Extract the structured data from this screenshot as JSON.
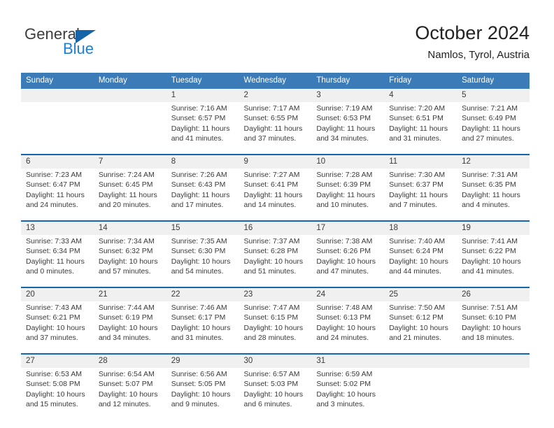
{
  "brand": {
    "name_part1": "General",
    "name_part2": "Blue",
    "triangle_icon": "triangle-icon",
    "accent_dark": "#1565a8",
    "accent_light": "#1d7fd4"
  },
  "header": {
    "title": "October 2024",
    "subtitle": "Namlos, Tyrol, Austria"
  },
  "theme": {
    "header_bg": "#3b7cb8",
    "header_text": "#ffffff",
    "daynum_bg": "#f0f0f0",
    "rule_color": "#1565a8"
  },
  "weekday_headers": [
    "Sunday",
    "Monday",
    "Tuesday",
    "Wednesday",
    "Thursday",
    "Friday",
    "Saturday"
  ],
  "labels": {
    "sunrise_prefix": "Sunrise:",
    "sunset_prefix": "Sunset:",
    "daylight_prefix": "Daylight:"
  },
  "weeks": [
    {
      "days": [
        {
          "num": "",
          "sunrise": "",
          "sunset": "",
          "daylight_l1": "",
          "daylight_l2": "",
          "empty": true
        },
        {
          "num": "",
          "sunrise": "",
          "sunset": "",
          "daylight_l1": "",
          "daylight_l2": "",
          "empty": true
        },
        {
          "num": "1",
          "sunrise": "Sunrise: 7:16 AM",
          "sunset": "Sunset: 6:57 PM",
          "daylight_l1": "Daylight: 11 hours",
          "daylight_l2": "and 41 minutes.",
          "empty": false
        },
        {
          "num": "2",
          "sunrise": "Sunrise: 7:17 AM",
          "sunset": "Sunset: 6:55 PM",
          "daylight_l1": "Daylight: 11 hours",
          "daylight_l2": "and 37 minutes.",
          "empty": false
        },
        {
          "num": "3",
          "sunrise": "Sunrise: 7:19 AM",
          "sunset": "Sunset: 6:53 PM",
          "daylight_l1": "Daylight: 11 hours",
          "daylight_l2": "and 34 minutes.",
          "empty": false
        },
        {
          "num": "4",
          "sunrise": "Sunrise: 7:20 AM",
          "sunset": "Sunset: 6:51 PM",
          "daylight_l1": "Daylight: 11 hours",
          "daylight_l2": "and 31 minutes.",
          "empty": false
        },
        {
          "num": "5",
          "sunrise": "Sunrise: 7:21 AM",
          "sunset": "Sunset: 6:49 PM",
          "daylight_l1": "Daylight: 11 hours",
          "daylight_l2": "and 27 minutes.",
          "empty": false
        }
      ]
    },
    {
      "days": [
        {
          "num": "6",
          "sunrise": "Sunrise: 7:23 AM",
          "sunset": "Sunset: 6:47 PM",
          "daylight_l1": "Daylight: 11 hours",
          "daylight_l2": "and 24 minutes.",
          "empty": false
        },
        {
          "num": "7",
          "sunrise": "Sunrise: 7:24 AM",
          "sunset": "Sunset: 6:45 PM",
          "daylight_l1": "Daylight: 11 hours",
          "daylight_l2": "and 20 minutes.",
          "empty": false
        },
        {
          "num": "8",
          "sunrise": "Sunrise: 7:26 AM",
          "sunset": "Sunset: 6:43 PM",
          "daylight_l1": "Daylight: 11 hours",
          "daylight_l2": "and 17 minutes.",
          "empty": false
        },
        {
          "num": "9",
          "sunrise": "Sunrise: 7:27 AM",
          "sunset": "Sunset: 6:41 PM",
          "daylight_l1": "Daylight: 11 hours",
          "daylight_l2": "and 14 minutes.",
          "empty": false
        },
        {
          "num": "10",
          "sunrise": "Sunrise: 7:28 AM",
          "sunset": "Sunset: 6:39 PM",
          "daylight_l1": "Daylight: 11 hours",
          "daylight_l2": "and 10 minutes.",
          "empty": false
        },
        {
          "num": "11",
          "sunrise": "Sunrise: 7:30 AM",
          "sunset": "Sunset: 6:37 PM",
          "daylight_l1": "Daylight: 11 hours",
          "daylight_l2": "and 7 minutes.",
          "empty": false
        },
        {
          "num": "12",
          "sunrise": "Sunrise: 7:31 AM",
          "sunset": "Sunset: 6:35 PM",
          "daylight_l1": "Daylight: 11 hours",
          "daylight_l2": "and 4 minutes.",
          "empty": false
        }
      ]
    },
    {
      "days": [
        {
          "num": "13",
          "sunrise": "Sunrise: 7:33 AM",
          "sunset": "Sunset: 6:34 PM",
          "daylight_l1": "Daylight: 11 hours",
          "daylight_l2": "and 0 minutes.",
          "empty": false
        },
        {
          "num": "14",
          "sunrise": "Sunrise: 7:34 AM",
          "sunset": "Sunset: 6:32 PM",
          "daylight_l1": "Daylight: 10 hours",
          "daylight_l2": "and 57 minutes.",
          "empty": false
        },
        {
          "num": "15",
          "sunrise": "Sunrise: 7:35 AM",
          "sunset": "Sunset: 6:30 PM",
          "daylight_l1": "Daylight: 10 hours",
          "daylight_l2": "and 54 minutes.",
          "empty": false
        },
        {
          "num": "16",
          "sunrise": "Sunrise: 7:37 AM",
          "sunset": "Sunset: 6:28 PM",
          "daylight_l1": "Daylight: 10 hours",
          "daylight_l2": "and 51 minutes.",
          "empty": false
        },
        {
          "num": "17",
          "sunrise": "Sunrise: 7:38 AM",
          "sunset": "Sunset: 6:26 PM",
          "daylight_l1": "Daylight: 10 hours",
          "daylight_l2": "and 47 minutes.",
          "empty": false
        },
        {
          "num": "18",
          "sunrise": "Sunrise: 7:40 AM",
          "sunset": "Sunset: 6:24 PM",
          "daylight_l1": "Daylight: 10 hours",
          "daylight_l2": "and 44 minutes.",
          "empty": false
        },
        {
          "num": "19",
          "sunrise": "Sunrise: 7:41 AM",
          "sunset": "Sunset: 6:22 PM",
          "daylight_l1": "Daylight: 10 hours",
          "daylight_l2": "and 41 minutes.",
          "empty": false
        }
      ]
    },
    {
      "days": [
        {
          "num": "20",
          "sunrise": "Sunrise: 7:43 AM",
          "sunset": "Sunset: 6:21 PM",
          "daylight_l1": "Daylight: 10 hours",
          "daylight_l2": "and 37 minutes.",
          "empty": false
        },
        {
          "num": "21",
          "sunrise": "Sunrise: 7:44 AM",
          "sunset": "Sunset: 6:19 PM",
          "daylight_l1": "Daylight: 10 hours",
          "daylight_l2": "and 34 minutes.",
          "empty": false
        },
        {
          "num": "22",
          "sunrise": "Sunrise: 7:46 AM",
          "sunset": "Sunset: 6:17 PM",
          "daylight_l1": "Daylight: 10 hours",
          "daylight_l2": "and 31 minutes.",
          "empty": false
        },
        {
          "num": "23",
          "sunrise": "Sunrise: 7:47 AM",
          "sunset": "Sunset: 6:15 PM",
          "daylight_l1": "Daylight: 10 hours",
          "daylight_l2": "and 28 minutes.",
          "empty": false
        },
        {
          "num": "24",
          "sunrise": "Sunrise: 7:48 AM",
          "sunset": "Sunset: 6:13 PM",
          "daylight_l1": "Daylight: 10 hours",
          "daylight_l2": "and 24 minutes.",
          "empty": false
        },
        {
          "num": "25",
          "sunrise": "Sunrise: 7:50 AM",
          "sunset": "Sunset: 6:12 PM",
          "daylight_l1": "Daylight: 10 hours",
          "daylight_l2": "and 21 minutes.",
          "empty": false
        },
        {
          "num": "26",
          "sunrise": "Sunrise: 7:51 AM",
          "sunset": "Sunset: 6:10 PM",
          "daylight_l1": "Daylight: 10 hours",
          "daylight_l2": "and 18 minutes.",
          "empty": false
        }
      ]
    },
    {
      "days": [
        {
          "num": "27",
          "sunrise": "Sunrise: 6:53 AM",
          "sunset": "Sunset: 5:08 PM",
          "daylight_l1": "Daylight: 10 hours",
          "daylight_l2": "and 15 minutes.",
          "empty": false
        },
        {
          "num": "28",
          "sunrise": "Sunrise: 6:54 AM",
          "sunset": "Sunset: 5:07 PM",
          "daylight_l1": "Daylight: 10 hours",
          "daylight_l2": "and 12 minutes.",
          "empty": false
        },
        {
          "num": "29",
          "sunrise": "Sunrise: 6:56 AM",
          "sunset": "Sunset: 5:05 PM",
          "daylight_l1": "Daylight: 10 hours",
          "daylight_l2": "and 9 minutes.",
          "empty": false
        },
        {
          "num": "30",
          "sunrise": "Sunrise: 6:57 AM",
          "sunset": "Sunset: 5:03 PM",
          "daylight_l1": "Daylight: 10 hours",
          "daylight_l2": "and 6 minutes.",
          "empty": false
        },
        {
          "num": "31",
          "sunrise": "Sunrise: 6:59 AM",
          "sunset": "Sunset: 5:02 PM",
          "daylight_l1": "Daylight: 10 hours",
          "daylight_l2": "and 3 minutes.",
          "empty": false
        },
        {
          "num": "",
          "sunrise": "",
          "sunset": "",
          "daylight_l1": "",
          "daylight_l2": "",
          "empty": true
        },
        {
          "num": "",
          "sunrise": "",
          "sunset": "",
          "daylight_l1": "",
          "daylight_l2": "",
          "empty": true
        }
      ]
    }
  ]
}
